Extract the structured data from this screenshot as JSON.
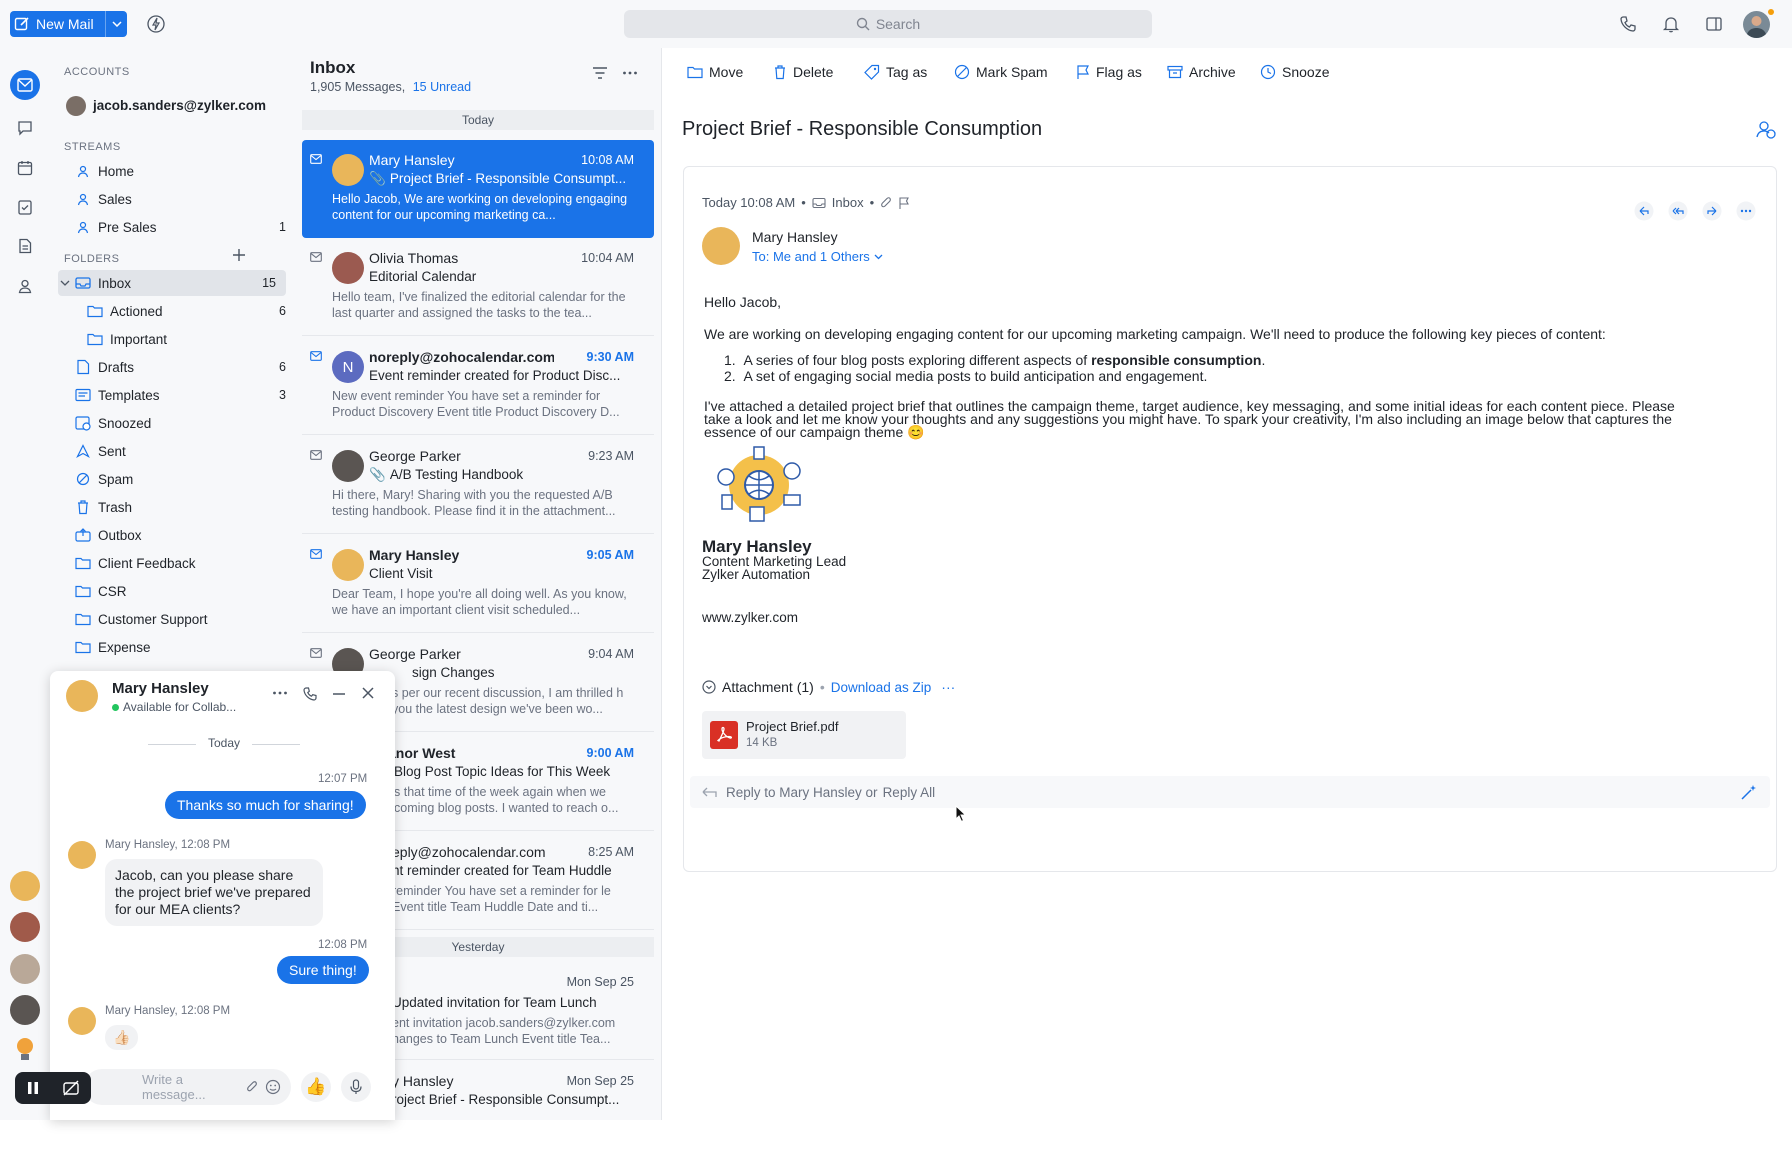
{
  "topbar": {
    "new_mail_label": "New Mail",
    "search_placeholder": "Search"
  },
  "folders": {
    "accounts_header": "ACCOUNTS",
    "account_email": "jacob.sanders@zylker.com",
    "streams_header": "STREAMS",
    "streams": [
      {
        "label": "Home",
        "count": ""
      },
      {
        "label": "Sales",
        "count": ""
      },
      {
        "label": "Pre Sales",
        "count": "1"
      }
    ],
    "folders_header": "FOLDERS",
    "items": [
      {
        "label": "Inbox",
        "count": "15"
      },
      {
        "label": "Actioned",
        "count": "6"
      },
      {
        "label": "Important",
        "count": ""
      },
      {
        "label": "Drafts",
        "count": "6"
      },
      {
        "label": "Templates",
        "count": "3"
      },
      {
        "label": "Snoozed",
        "count": ""
      },
      {
        "label": "Sent",
        "count": ""
      },
      {
        "label": "Spam",
        "count": ""
      },
      {
        "label": "Trash",
        "count": ""
      },
      {
        "label": "Outbox",
        "count": ""
      },
      {
        "label": "Client Feedback",
        "count": ""
      },
      {
        "label": "CSR",
        "count": ""
      },
      {
        "label": "Customer Support",
        "count": ""
      },
      {
        "label": "Expense",
        "count": ""
      }
    ]
  },
  "list": {
    "title": "Inbox",
    "message_count": "1,905 Messages,",
    "unread": "15 Unread",
    "today": "Today",
    "yesterday": "Yesterday",
    "messages": [
      {
        "from": "Mary Hansley",
        "time": "10:08 AM",
        "subject": "Project Brief - Responsible Consumpt...",
        "preview": "Hello Jacob, We are working on developing engaging content for our upcoming marketing ca..."
      },
      {
        "from": "Olivia Thomas",
        "time": "10:04 AM",
        "subject": "Editorial Calendar",
        "preview": "Hello team, I've finalized the editorial calendar for the last quarter and assigned the tasks to the tea..."
      },
      {
        "from": "noreply@zohocalendar.com",
        "time": "9:30 AM",
        "subject": "Event reminder created for Product Disc...",
        "preview": "New event reminder You have set a reminder for Product Discovery Event title Product Discovery D..."
      },
      {
        "from": "George Parker",
        "time": "9:23 AM",
        "subject": "A/B Testing Handbook",
        "preview": "Hi there, Mary! Sharing with you the requested A/B testing handbook. Please find it in the attachment..."
      },
      {
        "from": "Mary Hansley",
        "time": "9:05 AM",
        "subject": "Client Visit",
        "preview": "Dear Team, I hope you're all doing well. As you know, we have an important client visit scheduled..."
      },
      {
        "from": "George Parker",
        "time": "9:04 AM",
        "subject": "sign Changes",
        "preview": "s per our recent discussion, I am thrilled h you the latest design we've been wo..."
      },
      {
        "from": "anor West",
        "time": "9:00 AM",
        "subject": "Blog Post Topic Ideas for This Week",
        "preview": "s that time of the week again when we coming blog posts. I wanted to reach o..."
      },
      {
        "from": "eply@zohocalendar.com",
        "time": "8:25 AM",
        "subject": "nt reminder created for Team Huddle",
        "preview": "reminder You have set a reminder for le Event title Team Huddle Date and ti..."
      },
      {
        "from": "",
        "time": "Mon Sep 25",
        "subject": "Updated invitation for  Team Lunch",
        "preview": "ent invitation jacob.sanders@zylker.com hanges to Team Lunch Event title Tea..."
      },
      {
        "from": "y Hansley",
        "time": "Mon Sep 25",
        "subject": "roject Brief - Responsible Consumpt...",
        "preview": ""
      }
    ]
  },
  "reader": {
    "toolbar": [
      "Move",
      "Delete",
      "Tag as",
      "Mark Spam",
      "Flag as",
      "Archive",
      "Snooze"
    ],
    "subject": "Project Brief - Responsible Consumption",
    "meta_time": "Today 10:08 AM",
    "meta_folder": "Inbox",
    "sender": "Mary Hansley",
    "to": "To: Me and 1 Others",
    "greeting": "Hello Jacob,",
    "intro": "We are working on developing engaging content for our upcoming marketing campaign. We'll need to produce the following key pieces of content:",
    "item1_pre": "A series of four blog posts exploring different aspects of ",
    "item1_bold": "responsible consumption",
    "item1_post": ".",
    "item2": "A set of engaging social media posts to build anticipation and engagement.",
    "para_line1": "I've attached a detailed project brief that outlines the campaign theme, target audience, key messaging, and some initial ideas for each content piece. Please",
    "para_line2": "take a look and let me know your thoughts and any suggestions you might have. To spark your creativity, I'm also including an image below that captures the",
    "para_line3": "essence of our campaign theme 😊",
    "sig_name": "Mary Hansley",
    "sig_title": "Content Marketing Lead",
    "sig_company": "Zylker Automation",
    "sig_site": "www.zylker.com",
    "attachment_label": "Attachment (1)",
    "download_zip": "Download as Zip",
    "file_name": "Project Brief.pdf",
    "file_size": "14 KB",
    "reply_to": "Reply to Mary Hansley or",
    "reply_all": "Reply All"
  },
  "chat": {
    "name": "Mary Hansley",
    "status": "Available for Collab...",
    "day": "Today",
    "msg1_time": "12:07 PM",
    "msg1": "Thanks so much for sharing!",
    "msg2_meta": "Mary Hansley, 12:08 PM",
    "msg2": "Jacob, can you please share the project brief we've prepared for our MEA clients?",
    "msg3_time": "12:08 PM",
    "msg3": "Sure thing!",
    "msg4_meta": "Mary Hansley, 12:08 PM",
    "msg4": "👍🏻",
    "input_placeholder": "Write a message..."
  },
  "colors": {
    "accent": "#1a73e8",
    "unread_blue": "#1a73e8"
  }
}
